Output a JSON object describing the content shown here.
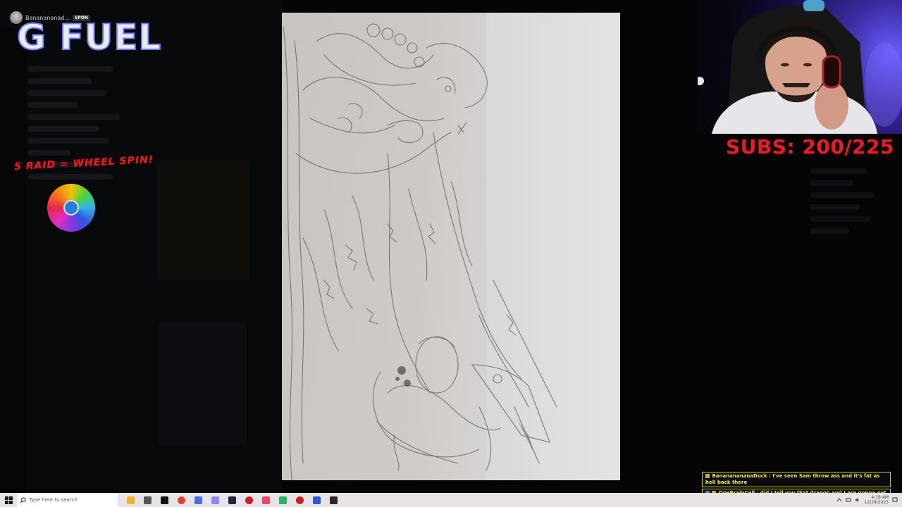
{
  "gfuel": {
    "username": "Bananananad...",
    "tag": "SPON",
    "logo_text": "G FUEL"
  },
  "raid": {
    "label": "5 RAID = WHEEL SPIN!"
  },
  "subs": {
    "label": "SUBS: 200/225"
  },
  "chat": {
    "messages": [
      {
        "text": "BanananananaDuck : I've seen Sam throw ass and it's fat as hell back there"
      },
      {
        "text": "OneBrainCell : did I tell you that dragon and I are gonna get a kittyyyyy???"
      }
    ]
  },
  "taskbar": {
    "search_placeholder": "Type here to search",
    "apps": [
      {
        "name": "file-explorer-icon",
        "color": "#e8b730"
      },
      {
        "name": "cat-app-icon",
        "color": "#555555"
      },
      {
        "name": "x-app-icon",
        "color": "#111111"
      },
      {
        "name": "chrome-icon",
        "color": "#db4437"
      },
      {
        "name": "browser-icon",
        "color": "#4a6fe0"
      },
      {
        "name": "store-icon",
        "color": "#8a8aef"
      },
      {
        "name": "steam-icon",
        "color": "#1b2838"
      },
      {
        "name": "opera-icon",
        "color": "#d21a2a"
      },
      {
        "name": "pin-icon",
        "color": "#e84a6a"
      },
      {
        "name": "game-icon",
        "color": "#2fae6c"
      },
      {
        "name": "record-icon",
        "color": "#cc2020"
      },
      {
        "name": "document-icon",
        "color": "#2b5cc9"
      },
      {
        "name": "terminal-icon",
        "color": "#2a2a2a"
      }
    ],
    "time": "4:19 AM",
    "date": "12/29/2025"
  },
  "colors": {
    "subs_red": "#e31d2a",
    "raid_red": "#e0202a",
    "chat_text": "#f2e85a",
    "chat_border": "#c8c838"
  }
}
